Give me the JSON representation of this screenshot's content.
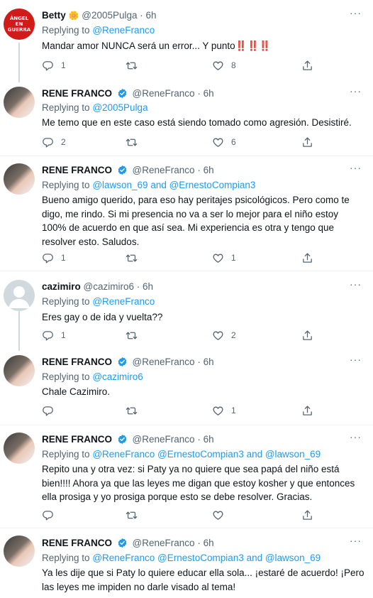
{
  "tweets": [
    {
      "name": "Betty",
      "emoji": "🌼",
      "handle": "@2005Pulga",
      "time": "6h",
      "reply_prefix": "Replying to",
      "mentions": "@ReneFranco",
      "text": "Mandar amor NUNCA será un error... Y punto‼️‼️‼️",
      "replies": "1",
      "retweets": "",
      "likes": "8",
      "avatar_text": "ÁNGEL EN GUERRA",
      "verified": false
    },
    {
      "name": "RENE FRANCO",
      "handle": "@ReneFranco",
      "time": "6h",
      "reply_prefix": "Replying to",
      "mentions": "@2005Pulga",
      "text": "Me temo que en este caso está siendo tomado como agresión. Desistiré.",
      "replies": "2",
      "retweets": "",
      "likes": "6",
      "verified": true
    },
    {
      "name": "RENE FRANCO",
      "handle": "@ReneFranco",
      "time": "6h",
      "reply_prefix": "Replying to",
      "mentions": "@lawson_69 and @ErnestoCompian3",
      "text": "Bueno amigo querido, para eso hay peritajes psicológicos. Pero como te digo, me rindo. Si mi presencia no va a ser lo mejor para el niño estoy 100% de acuerdo en que así sea. Mi experiencia es otra y tengo que resolver esto. Saludos.",
      "replies": "1",
      "retweets": "",
      "likes": "1",
      "verified": true
    },
    {
      "name": "cazimiro",
      "handle": "@cazimiro6",
      "time": "6h",
      "reply_prefix": "Replying to",
      "mentions": "@ReneFranco",
      "text": "Eres gay o de ida y vuelta??",
      "replies": "1",
      "retweets": "",
      "likes": "2",
      "verified": false
    },
    {
      "name": "RENE FRANCO",
      "handle": "@ReneFranco",
      "time": "6h",
      "reply_prefix": "Replying to",
      "mentions": "@cazimiro6",
      "text": "Chale Cazimiro.",
      "replies": "",
      "retweets": "",
      "likes": "1",
      "verified": true
    },
    {
      "name": "RENE FRANCO",
      "handle": "@ReneFranco",
      "time": "6h",
      "reply_prefix": "Replying to",
      "mentions": "@ReneFranco @ErnestoCompian3 and @lawson_69",
      "text": "Repito una y otra vez: si Paty ya no quiere que sea papá del niño está bien!!!! Ahora ya que las leyes me digan que estoy kosher y que entonces ella prosiga y yo prosiga porque esto se debe resolver. Gracias.",
      "replies": "",
      "retweets": "",
      "likes": "",
      "verified": true
    },
    {
      "name": "RENE FRANCO",
      "handle": "@ReneFranco",
      "time": "6h",
      "reply_prefix": "Replying to",
      "mentions": "@ReneFranco @ErnestoCompian3 and @lawson_69",
      "text": "Ya les dije que si Paty lo quiere educar ella sola... ¡estaré de acuerdo! ¡Pero las leyes me impiden no darle visado al tema!",
      "verified": true
    }
  ],
  "colors": {
    "accent": "#1d9bf0",
    "secondary_text": "#536471",
    "thread_line": "#cfd9de",
    "divider": "#eff3f4"
  },
  "icons": [
    "more-icon",
    "reply-icon",
    "retweet-icon",
    "like-icon",
    "share-icon",
    "verified-icon"
  ]
}
